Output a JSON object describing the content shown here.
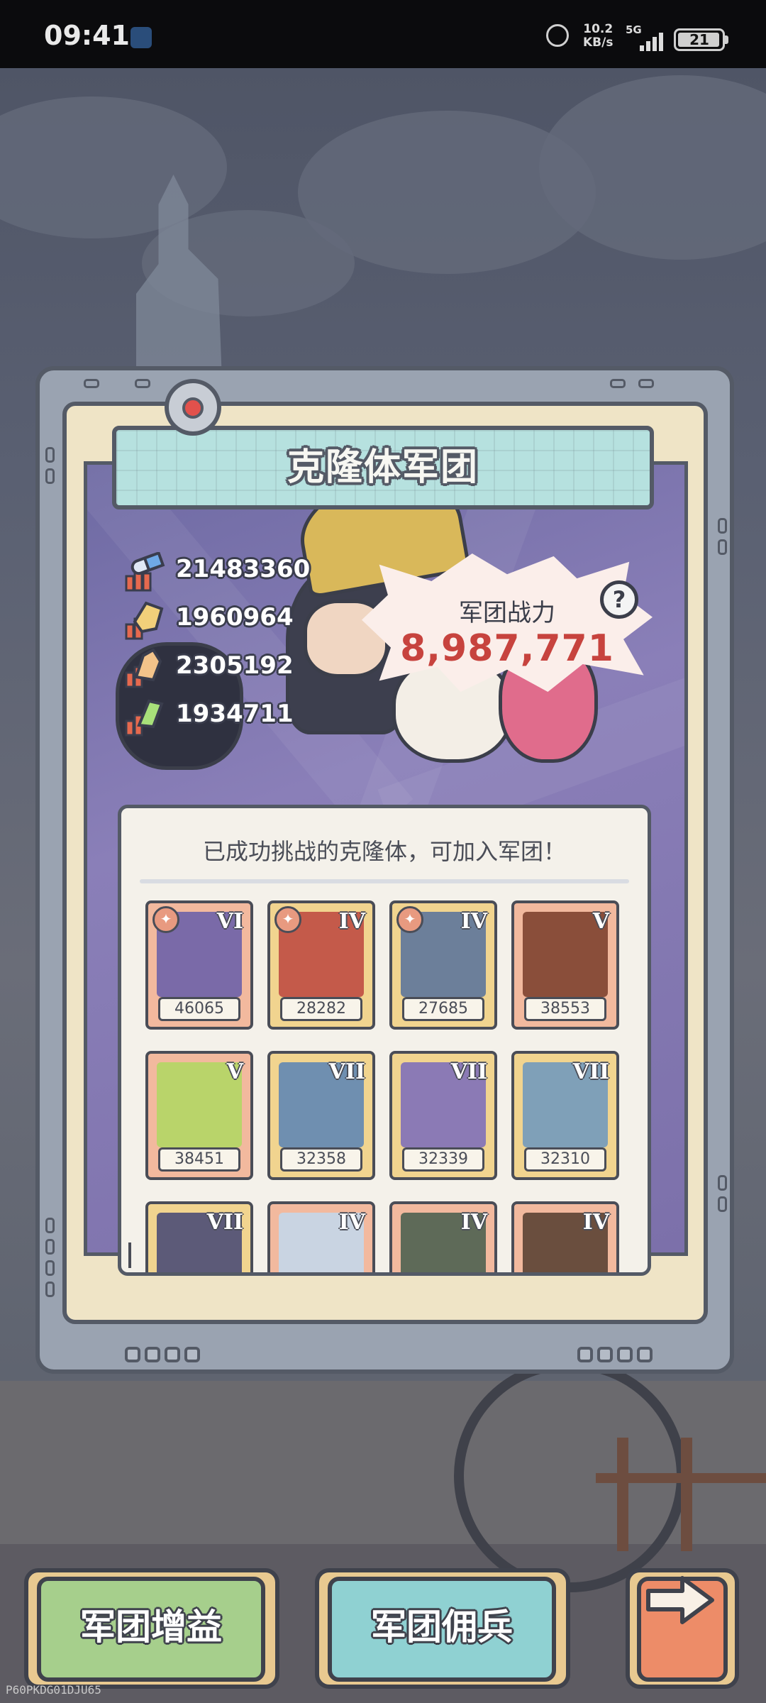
{
  "status_bar": {
    "time": "09:41",
    "speed_value": "10.2",
    "speed_unit": "KB/s",
    "network": "5G",
    "battery": "21"
  },
  "panel": {
    "title": "克隆体军团",
    "stats": [
      {
        "icon": "pill-icon",
        "value": "21483360"
      },
      {
        "icon": "shield-crystal-icon",
        "value": "1960964"
      },
      {
        "icon": "fist-crystal-icon",
        "value": "2305192"
      },
      {
        "icon": "lightning-crystal-icon",
        "value": "1934711"
      }
    ],
    "power_label": "军团战力",
    "power_value": "8,987,771",
    "help_label": "?"
  },
  "clone_list": {
    "heading": "已成功挑战的克隆体，可加入军团！",
    "cards": [
      {
        "rank": "VI",
        "power": "46065",
        "frame": "red",
        "joined": true,
        "portrait_color": "#7a6aa8"
      },
      {
        "rank": "IV",
        "power": "28282",
        "frame": "gold",
        "joined": true,
        "portrait_color": "#c45a4a"
      },
      {
        "rank": "IV",
        "power": "27685",
        "frame": "gold",
        "joined": true,
        "portrait_color": "#6c7f9a"
      },
      {
        "rank": "V",
        "power": "38553",
        "frame": "red",
        "joined": false,
        "portrait_color": "#8a4e3a"
      },
      {
        "rank": "V",
        "power": "38451",
        "frame": "red",
        "joined": false,
        "portrait_color": "#b9d46a"
      },
      {
        "rank": "VII",
        "power": "32358",
        "frame": "gold",
        "joined": false,
        "portrait_color": "#6f8fb0"
      },
      {
        "rank": "VII",
        "power": "32339",
        "frame": "gold",
        "joined": false,
        "portrait_color": "#8b7ab5"
      },
      {
        "rank": "VII",
        "power": "32310",
        "frame": "gold",
        "joined": false,
        "portrait_color": "#7fa0b8"
      },
      {
        "rank": "VII",
        "power": "",
        "frame": "gold",
        "joined": false,
        "portrait_color": "#5c5a78"
      },
      {
        "rank": "IV",
        "power": "",
        "frame": "red",
        "joined": false,
        "portrait_color": "#c9d4e2"
      },
      {
        "rank": "IV",
        "power": "",
        "frame": "red",
        "joined": false,
        "portrait_color": "#5e6a58"
      },
      {
        "rank": "IV",
        "power": "",
        "frame": "red",
        "joined": false,
        "portrait_color": "#6a4e3e"
      }
    ]
  },
  "buttons": {
    "buff": "军团增益",
    "mercenary": "军团佣兵",
    "next": "arrow-right-icon"
  },
  "watermark": "P60PKDG01DJU65"
}
